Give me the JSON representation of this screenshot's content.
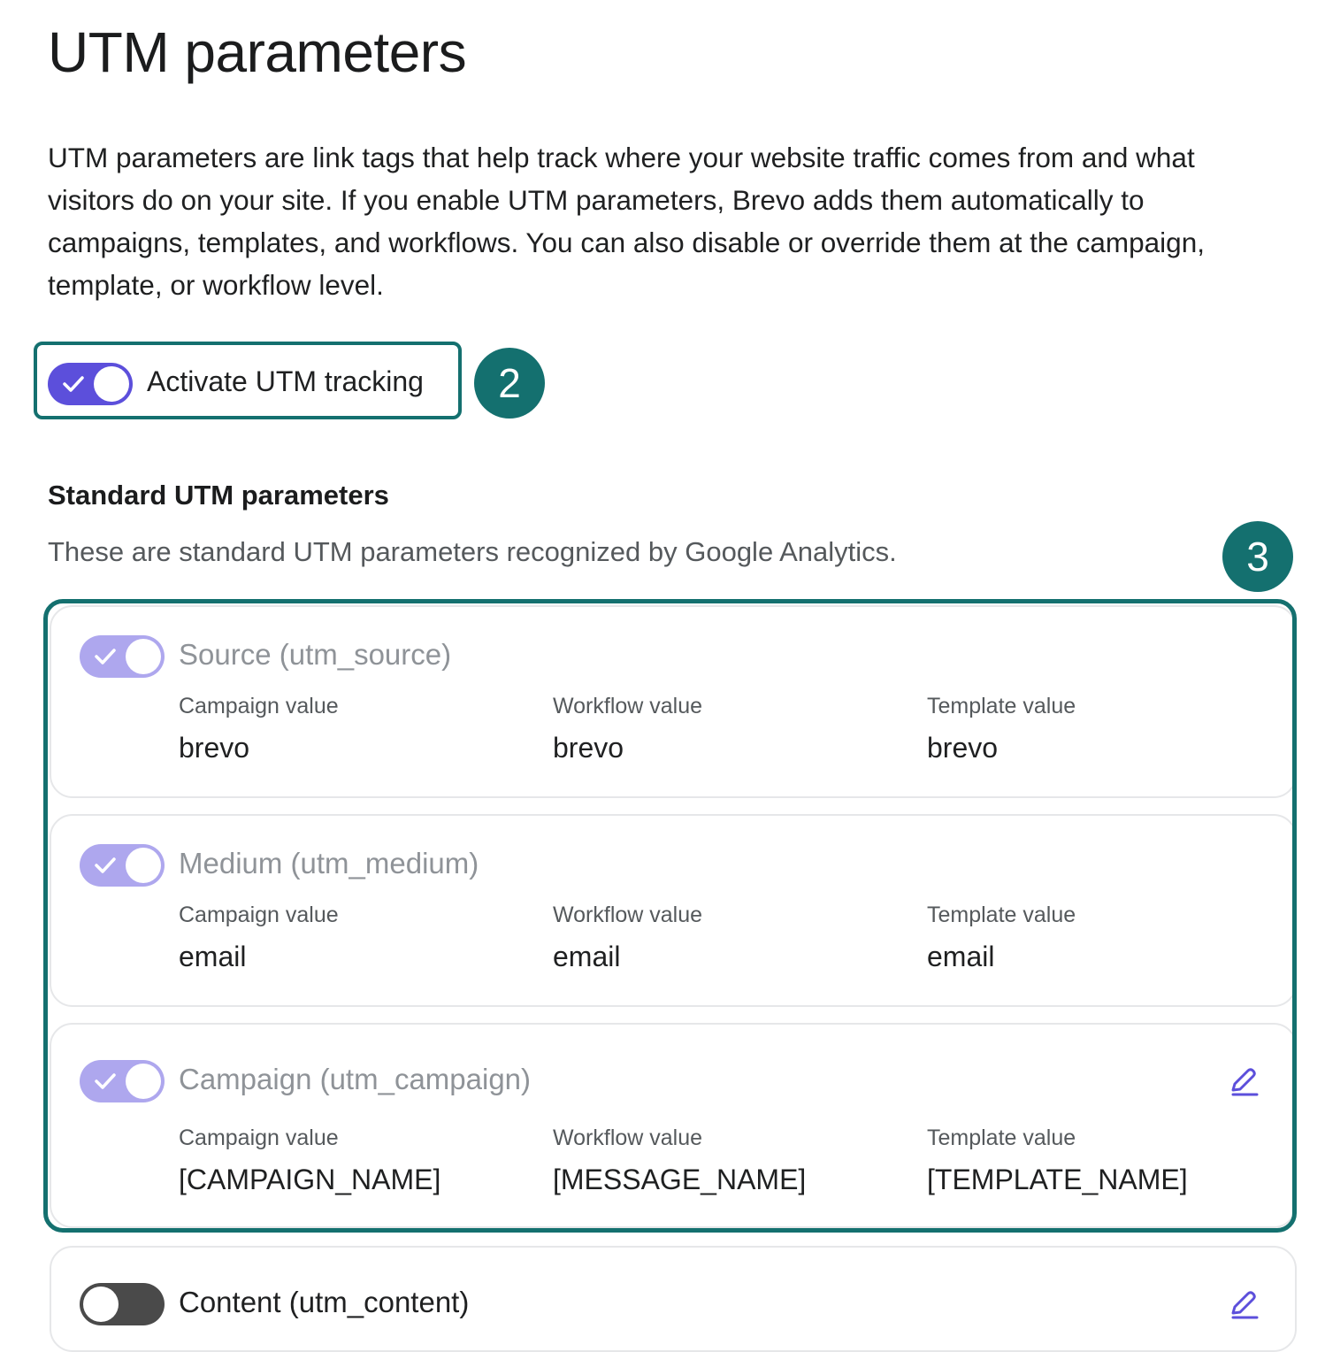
{
  "page": {
    "title": "UTM parameters",
    "description": "UTM parameters are link tags that help track where your website traffic comes from and what visitors do on your site. If you enable UTM parameters, Brevo adds them automatically to campaigns, templates, and workflows. You can also disable or override them at the campaign, template, or workflow level."
  },
  "activate": {
    "label": "Activate UTM tracking",
    "enabled": true
  },
  "steps": {
    "activate": "2",
    "parameters": "3"
  },
  "standard": {
    "title": "Standard UTM parameters",
    "subtitle": "These are standard UTM parameters recognized by Google Analytics."
  },
  "columns": {
    "campaign": "Campaign value",
    "workflow": "Workflow value",
    "template": "Template value"
  },
  "params": [
    {
      "name": "Source (utm_source)",
      "enabled": true,
      "locked": true,
      "campaign": "brevo",
      "workflow": "brevo",
      "template": "brevo"
    },
    {
      "name": "Medium (utm_medium)",
      "enabled": true,
      "locked": true,
      "campaign": "email",
      "workflow": "email",
      "template": "email"
    },
    {
      "name": "Campaign (utm_campaign)",
      "enabled": true,
      "locked": true,
      "campaign": "[CAMPAIGN_NAME]",
      "workflow": "[MESSAGE_NAME]",
      "template": "[TEMPLATE_NAME]"
    },
    {
      "name": "Content (utm_content)",
      "enabled": false,
      "locked": false
    }
  ],
  "colors": {
    "accent": "#5c4fdb",
    "accent_dim": "#aea7ee",
    "highlight": "#14706f"
  },
  "icons": {
    "check": "check-icon",
    "edit": "pencil-edit-icon"
  }
}
